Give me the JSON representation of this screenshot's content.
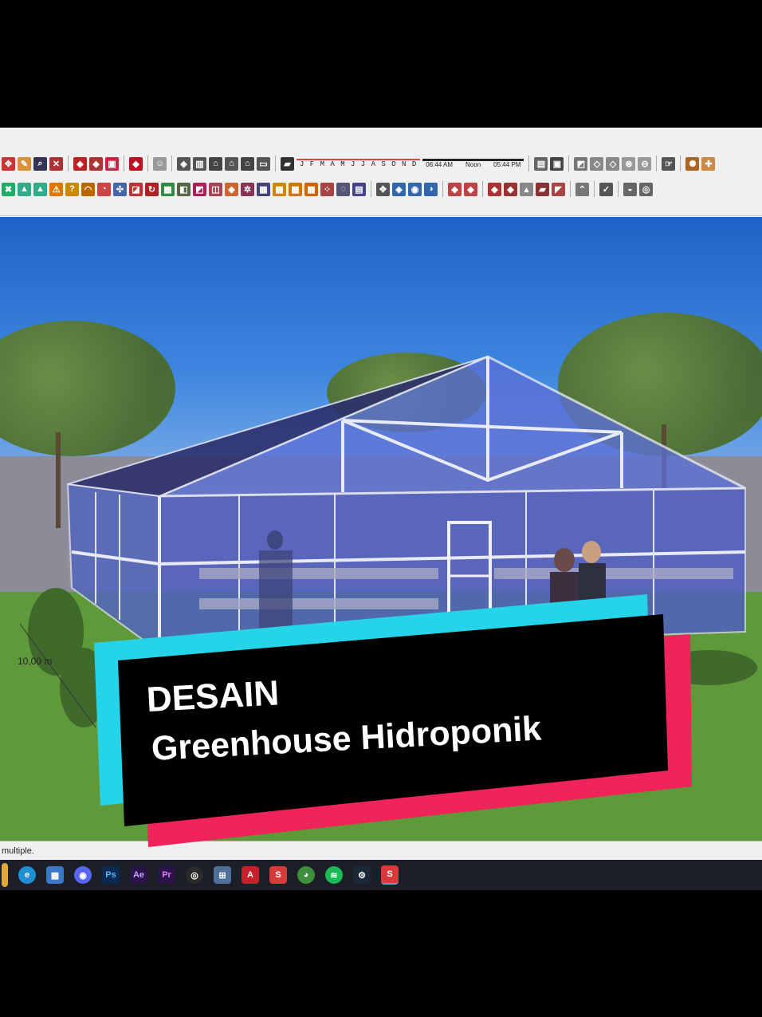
{
  "toolbar": {
    "row1_icons": [
      "move-icon",
      "paint-icon",
      "zoom-icon",
      "zoom-extents-icon",
      "component-icon",
      "materials-icon",
      "styles-icon",
      "ruby-icon",
      "account-icon",
      "section-icon",
      "iso-icon",
      "front-view-icon",
      "top-view-icon",
      "house-icon",
      "right-view-icon",
      "eraser-icon"
    ],
    "months": "J F M A M J J A S O N D",
    "time_start": "06:44 AM",
    "time_mid": "Noon",
    "time_end": "05:44 PM",
    "row1_right_icons": [
      "xray-icon",
      "back-edges-icon",
      "wireframe-icon",
      "hidden-line-icon",
      "shaded-icon",
      "textured-icon",
      "monochrome-icon",
      "layers-icon",
      "warehouse-icon",
      "ext-icon"
    ],
    "row2_icons": [
      "axes-icon",
      "dimension-icon",
      "protractor-icon",
      "text-icon",
      "3d-text-icon",
      "arc-icon",
      "pie-icon",
      "circle-icon",
      "polygon-icon",
      "push-pull-icon",
      "follow-me-icon",
      "offset-icon",
      "rotate-icon",
      "scale-icon",
      "flip-icon",
      "sandbox-icon",
      "grid-icon",
      "stamp-icon",
      "drape-icon",
      "smoove-icon",
      "add-detail-icon",
      "flip-edge-icon",
      "orbit-icon",
      "pan-icon",
      "walk-icon",
      "look-icon",
      "solid-union-icon",
      "solid-subtract-icon",
      "solid-trim-icon",
      "solid-split-icon",
      "outer-shell-icon",
      "intersect-icon",
      "check-icon",
      "model-info-icon",
      "settings-icon"
    ]
  },
  "viewport": {
    "dimension_label": "10,00 m"
  },
  "status": {
    "text": "multiple."
  },
  "taskbar": {
    "apps": [
      {
        "name": "taskbar-app-file-explorer",
        "label": "",
        "color": "#e0a83a"
      },
      {
        "name": "taskbar-app-edge",
        "label": "e",
        "color": "#1e8fd4"
      },
      {
        "name": "taskbar-app-store",
        "label": "▦",
        "color": "#3a78c9"
      },
      {
        "name": "taskbar-app-discord",
        "label": "◉",
        "color": "#5865f2"
      },
      {
        "name": "taskbar-app-photoshop",
        "label": "Ps",
        "color": "#0b2a52"
      },
      {
        "name": "taskbar-app-after-effects",
        "label": "Ae",
        "color": "#2a1448"
      },
      {
        "name": "taskbar-app-premiere",
        "label": "Pr",
        "color": "#2a1448"
      },
      {
        "name": "taskbar-app-obs",
        "label": "◎",
        "color": "#2b2b2b"
      },
      {
        "name": "taskbar-app-tool",
        "label": "⊞",
        "color": "#4d6f9a"
      },
      {
        "name": "taskbar-app-autocad",
        "label": "A",
        "color": "#c8202a"
      },
      {
        "name": "taskbar-app-sketchup-1",
        "label": "S",
        "color": "#d83a3a"
      },
      {
        "name": "taskbar-app-chrome",
        "label": "◕",
        "color": "#3d8f3d"
      },
      {
        "name": "taskbar-app-spotify",
        "label": "≋",
        "color": "#1db954"
      },
      {
        "name": "taskbar-app-steam",
        "label": "⚙",
        "color": "#1b2838"
      },
      {
        "name": "taskbar-app-sketchup-2",
        "label": "S",
        "color": "#d83a3a"
      }
    ]
  },
  "overlay": {
    "line1": "DESAIN",
    "line2": "Greenhouse Hidroponik",
    "colors": {
      "panel": "#000000",
      "cyan": "#25d4e8",
      "pink": "#f0245a"
    }
  }
}
